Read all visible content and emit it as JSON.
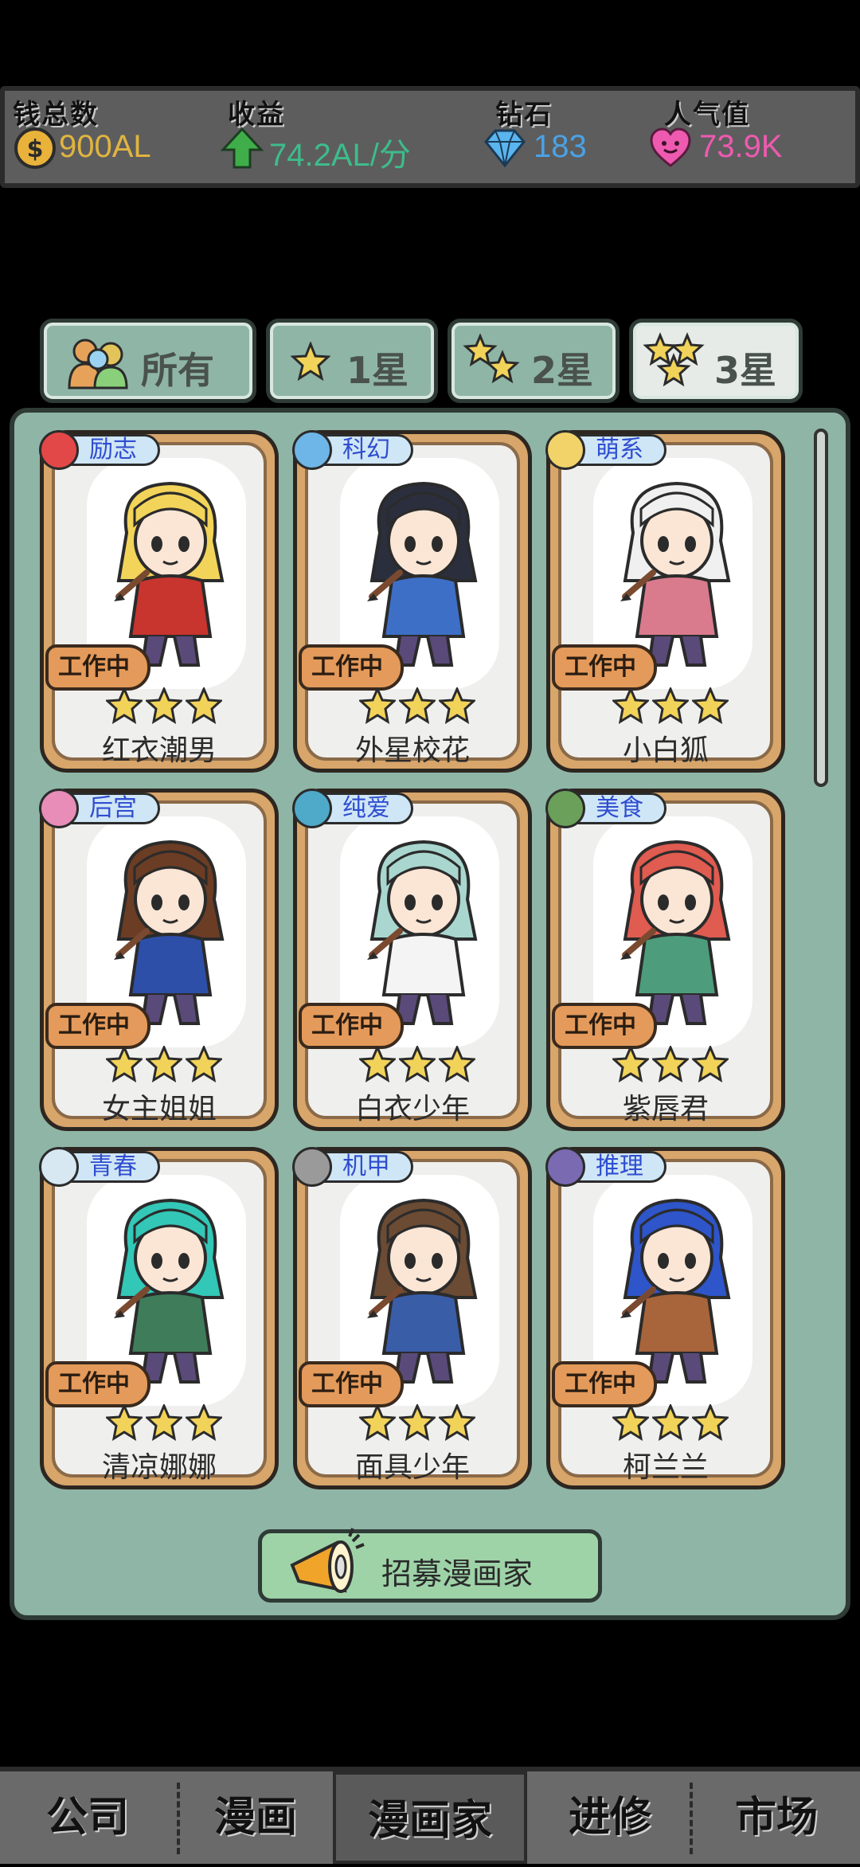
{
  "stats": {
    "money": {
      "label": "钱总数",
      "value": "900AL"
    },
    "income": {
      "label": "收益",
      "value": "74.2AL/分"
    },
    "diamonds": {
      "label": "钻石",
      "value": "183"
    },
    "popularity": {
      "label": "人气值",
      "value": "73.9K"
    }
  },
  "tabs": [
    {
      "label": "所有",
      "stars": 0,
      "active": false
    },
    {
      "label": "1星",
      "stars": 1,
      "active": false
    },
    {
      "label": "2星",
      "stars": 2,
      "active": false
    },
    {
      "label": "3星",
      "stars": 3,
      "active": true
    }
  ],
  "cards": [
    {
      "name": "红衣潮男",
      "genre": "励志",
      "status": "工作中",
      "stars": 3,
      "hair": "#f2d45a",
      "outfit": "#c8342e",
      "tagIcon": "#e34848"
    },
    {
      "name": "外星校花",
      "genre": "科幻",
      "status": "工作中",
      "stars": 3,
      "hair": "#2b2f3d",
      "outfit": "#3e6fc6",
      "tagIcon": "#6fb6e8"
    },
    {
      "name": "小白狐",
      "genre": "萌系",
      "status": "工作中",
      "stars": 3,
      "hair": "#f0f0f0",
      "outfit": "#d97b8c",
      "tagIcon": "#f1d36a"
    },
    {
      "name": "女主姐姐",
      "genre": "后宫",
      "status": "工作中",
      "stars": 3,
      "hair": "#6b3d24",
      "outfit": "#2e4fa8",
      "tagIcon": "#e78db8"
    },
    {
      "name": "白衣少年",
      "genre": "纯爱",
      "status": "工作中",
      "stars": 3,
      "hair": "#a9d7cf",
      "outfit": "#f4f4f4",
      "tagIcon": "#4fa9c9"
    },
    {
      "name": "紫唇君",
      "genre": "美食",
      "status": "工作中",
      "stars": 3,
      "hair": "#e05b50",
      "outfit": "#4d9d7c",
      "tagIcon": "#6aa05a"
    },
    {
      "name": "清凉娜娜",
      "genre": "青春",
      "status": "工作中",
      "stars": 3,
      "hair": "#33c7b7",
      "outfit": "#3f7d5a",
      "tagIcon": "#d8e8f2"
    },
    {
      "name": "面具少年",
      "genre": "机甲",
      "status": "工作中",
      "stars": 3,
      "hair": "#6b4b33",
      "outfit": "#3a5da8",
      "tagIcon": "#9a9a9a"
    },
    {
      "name": "柯兰兰",
      "genre": "推理",
      "status": "工作中",
      "stars": 3,
      "hair": "#2e55c9",
      "outfit": "#a8643a",
      "tagIcon": "#7a6ab2"
    }
  ],
  "recruit": {
    "label": "招募漫画家"
  },
  "nav": [
    {
      "label": "公司",
      "active": false
    },
    {
      "label": "漫画",
      "active": false
    },
    {
      "label": "漫画家",
      "active": true
    },
    {
      "label": "进修",
      "active": false
    },
    {
      "label": "市场",
      "active": false
    }
  ]
}
